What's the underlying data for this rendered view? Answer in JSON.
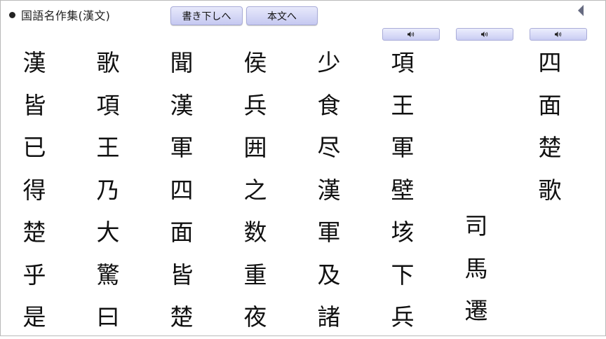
{
  "header": {
    "title": "国語名作集(漢文)"
  },
  "buttons": {
    "kudashi": "書き下しへ",
    "honbun": "本文へ"
  },
  "audio_icon": "speaker-icon",
  "columns": [
    [
      "漢",
      "皆",
      "已",
      "得",
      "楚",
      "乎",
      "是"
    ],
    [
      "歌",
      "項",
      "王",
      "乃",
      "大",
      "驚",
      "曰"
    ],
    [
      "聞",
      "漢",
      "軍",
      "四",
      "面",
      "皆",
      "楚"
    ],
    [
      "侯",
      "兵",
      "囲",
      "之",
      "数",
      "重",
      "夜"
    ],
    [
      "少",
      "食",
      "尽",
      "漢",
      "軍",
      "及",
      "諸"
    ],
    [
      "項",
      "王",
      "軍",
      "壁",
      "垓",
      "下",
      "兵"
    ],
    [
      "司",
      "馬",
      "遷"
    ],
    [
      "四",
      "面",
      "楚",
      "歌"
    ]
  ]
}
